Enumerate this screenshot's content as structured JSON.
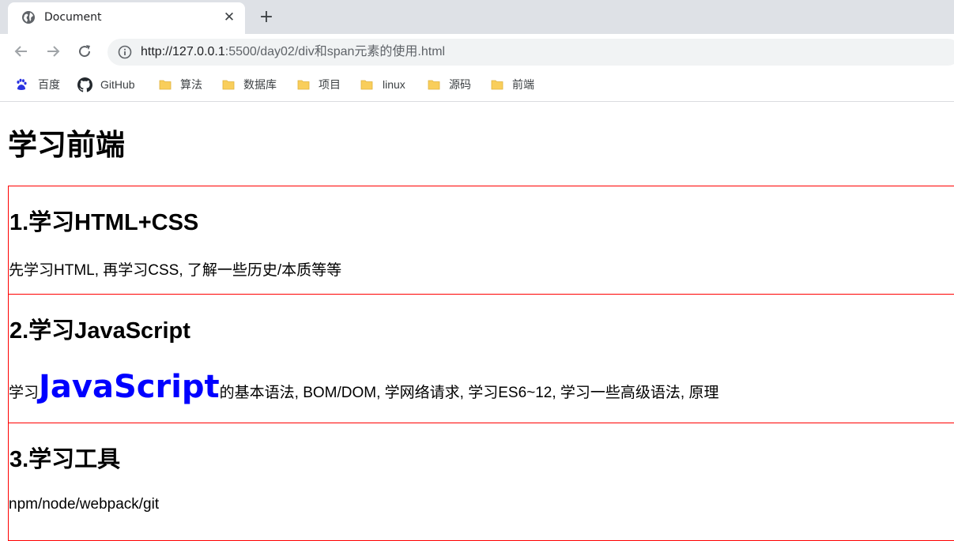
{
  "browser": {
    "tab": {
      "title": "Document",
      "icon": "globe-icon",
      "close_label": "✕"
    },
    "new_tab_label": "+",
    "nav": {
      "back_icon": "back-arrow-icon",
      "forward_icon": "forward-arrow-icon",
      "reload_icon": "reload-icon"
    },
    "url": {
      "host": "http://127.0.0.1",
      "rest": ":5500/day02/div和span元素的使用.html"
    },
    "bookmarks": [
      {
        "label": "百度",
        "icon": "baidu-icon"
      },
      {
        "label": "GitHub",
        "icon": "github-icon"
      },
      {
        "label": "算法",
        "icon": "folder-icon"
      },
      {
        "label": "数据库",
        "icon": "folder-icon"
      },
      {
        "label": "项目",
        "icon": "folder-icon"
      },
      {
        "label": "linux",
        "icon": "folder-icon"
      },
      {
        "label": "源码",
        "icon": "folder-icon"
      },
      {
        "label": "前端",
        "icon": "folder-icon"
      }
    ]
  },
  "page": {
    "title": "学习前端",
    "sections": [
      {
        "heading": "1.学习HTML+CSS",
        "text": "先学习HTML, 再学习CSS, 了解一些历史/本质等等"
      },
      {
        "heading": "2.学习JavaScript",
        "text_before": "学习",
        "highlight": "JavaScript",
        "text_after": "的基本语法, BOM/DOM, 学网络请求, 学习ES6~12, 学习一些高级语法, 原理"
      },
      {
        "heading": "3.学习工具",
        "text": "npm/node/webpack/git"
      }
    ]
  },
  "colors": {
    "section_border": "#ff0000",
    "highlight": "#0000ff",
    "folder": "#ffd866"
  }
}
